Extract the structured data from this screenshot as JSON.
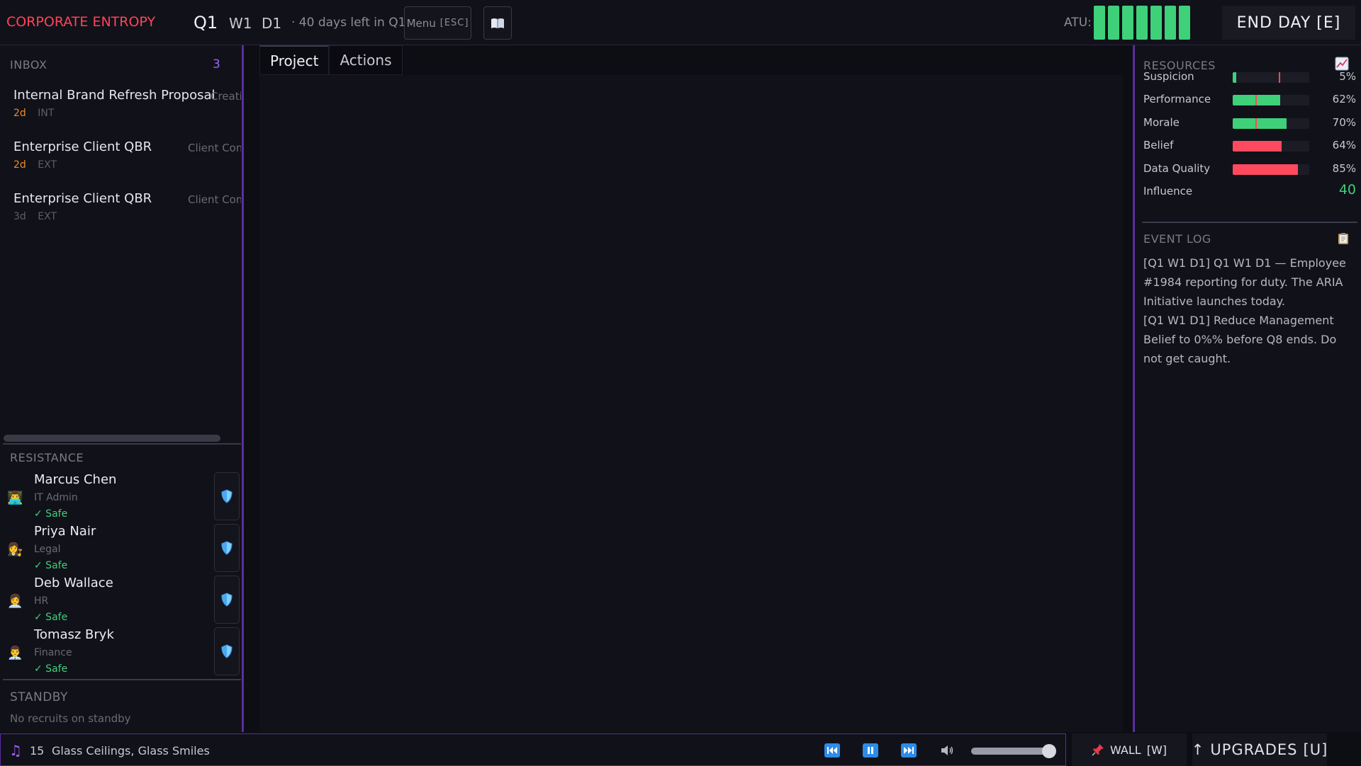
{
  "header": {
    "logo": "CORPORATE ENTROPY",
    "quarter": "Q1",
    "week": "W1",
    "day": "D1",
    "days_left": "· 40 days left in Q1",
    "menu_label": "Menu",
    "menu_key": "[ESC]",
    "book_icon": "book-icon",
    "atu_label": "ATU:",
    "atu_segments": 7,
    "atu_color": "#3fd07a",
    "end_day_label": "END DAY  [E]"
  },
  "inbox": {
    "title": "INBOX",
    "count": "3",
    "items": [
      {
        "title": "Internal Brand Refresh Proposal",
        "tag": "Creati",
        "due": "2d",
        "type": "INT"
      },
      {
        "title": "Enterprise Client QBR",
        "tag": "Client Com",
        "due": "2d",
        "type": "EXT"
      },
      {
        "title": "Enterprise Client QBR",
        "tag": "Client Com",
        "due": "3d",
        "type": "EXT"
      }
    ]
  },
  "resistance": {
    "title": "RESISTANCE",
    "members": [
      {
        "name": "Marcus Chen",
        "role": "IT Admin",
        "status": "✓ Safe",
        "avatar": "👨‍💻"
      },
      {
        "name": "Priya Nair",
        "role": "Legal",
        "status": "✓ Safe",
        "avatar": "👩‍⚖️"
      },
      {
        "name": "Deb Wallace",
        "role": "HR",
        "status": "✓ Safe",
        "avatar": "👩‍💼"
      },
      {
        "name": "Tomasz Bryk",
        "role": "Finance",
        "status": "✓ Safe",
        "avatar": "👨‍💼"
      }
    ]
  },
  "standby": {
    "title": "STANDBY",
    "empty_text": "No recruits on standby"
  },
  "tabs": [
    {
      "label": "Project",
      "active": true
    },
    {
      "label": "Actions",
      "active": false
    }
  ],
  "resources": {
    "title": "RESOURCES",
    "rows": [
      {
        "name": "Suspicion",
        "value": "5%",
        "fill": 0.05,
        "color": "#3fd07a",
        "marker": 0.6
      },
      {
        "name": "Performance",
        "value": "62%",
        "fill": 0.62,
        "color": "#3fd07a",
        "marker": 0.3
      },
      {
        "name": "Morale",
        "value": "70%",
        "fill": 0.7,
        "color": "#3fd07a",
        "marker": 0.3
      },
      {
        "name": "Belief",
        "value": "64%",
        "fill": 0.64,
        "color": "#ff4a5e",
        "marker": null
      },
      {
        "name": "Data Quality",
        "value": "85%",
        "fill": 0.85,
        "color": "#ff4a5e",
        "marker": null
      }
    ],
    "influence_label": "Influence",
    "influence_value": "40"
  },
  "event_log": {
    "title": "EVENT LOG",
    "entries": [
      "[Q1 W1 D1] Q1 W1 D1 — Employee #1984 reporting for duty. The ARIA Initiative launches today.",
      "[Q1 W1 D1] Reduce Management Belief to 0%% before Q8 ends. Do not get caught."
    ]
  },
  "music": {
    "track_number": "15",
    "track_name": "Glass Ceilings, Glass Smiles",
    "volume": 0.95
  },
  "bottom_buttons": {
    "wall_label": "WALL",
    "wall_key": "[W]",
    "upgrades_label": "UPGRADES",
    "upgrades_key": "[U]"
  }
}
